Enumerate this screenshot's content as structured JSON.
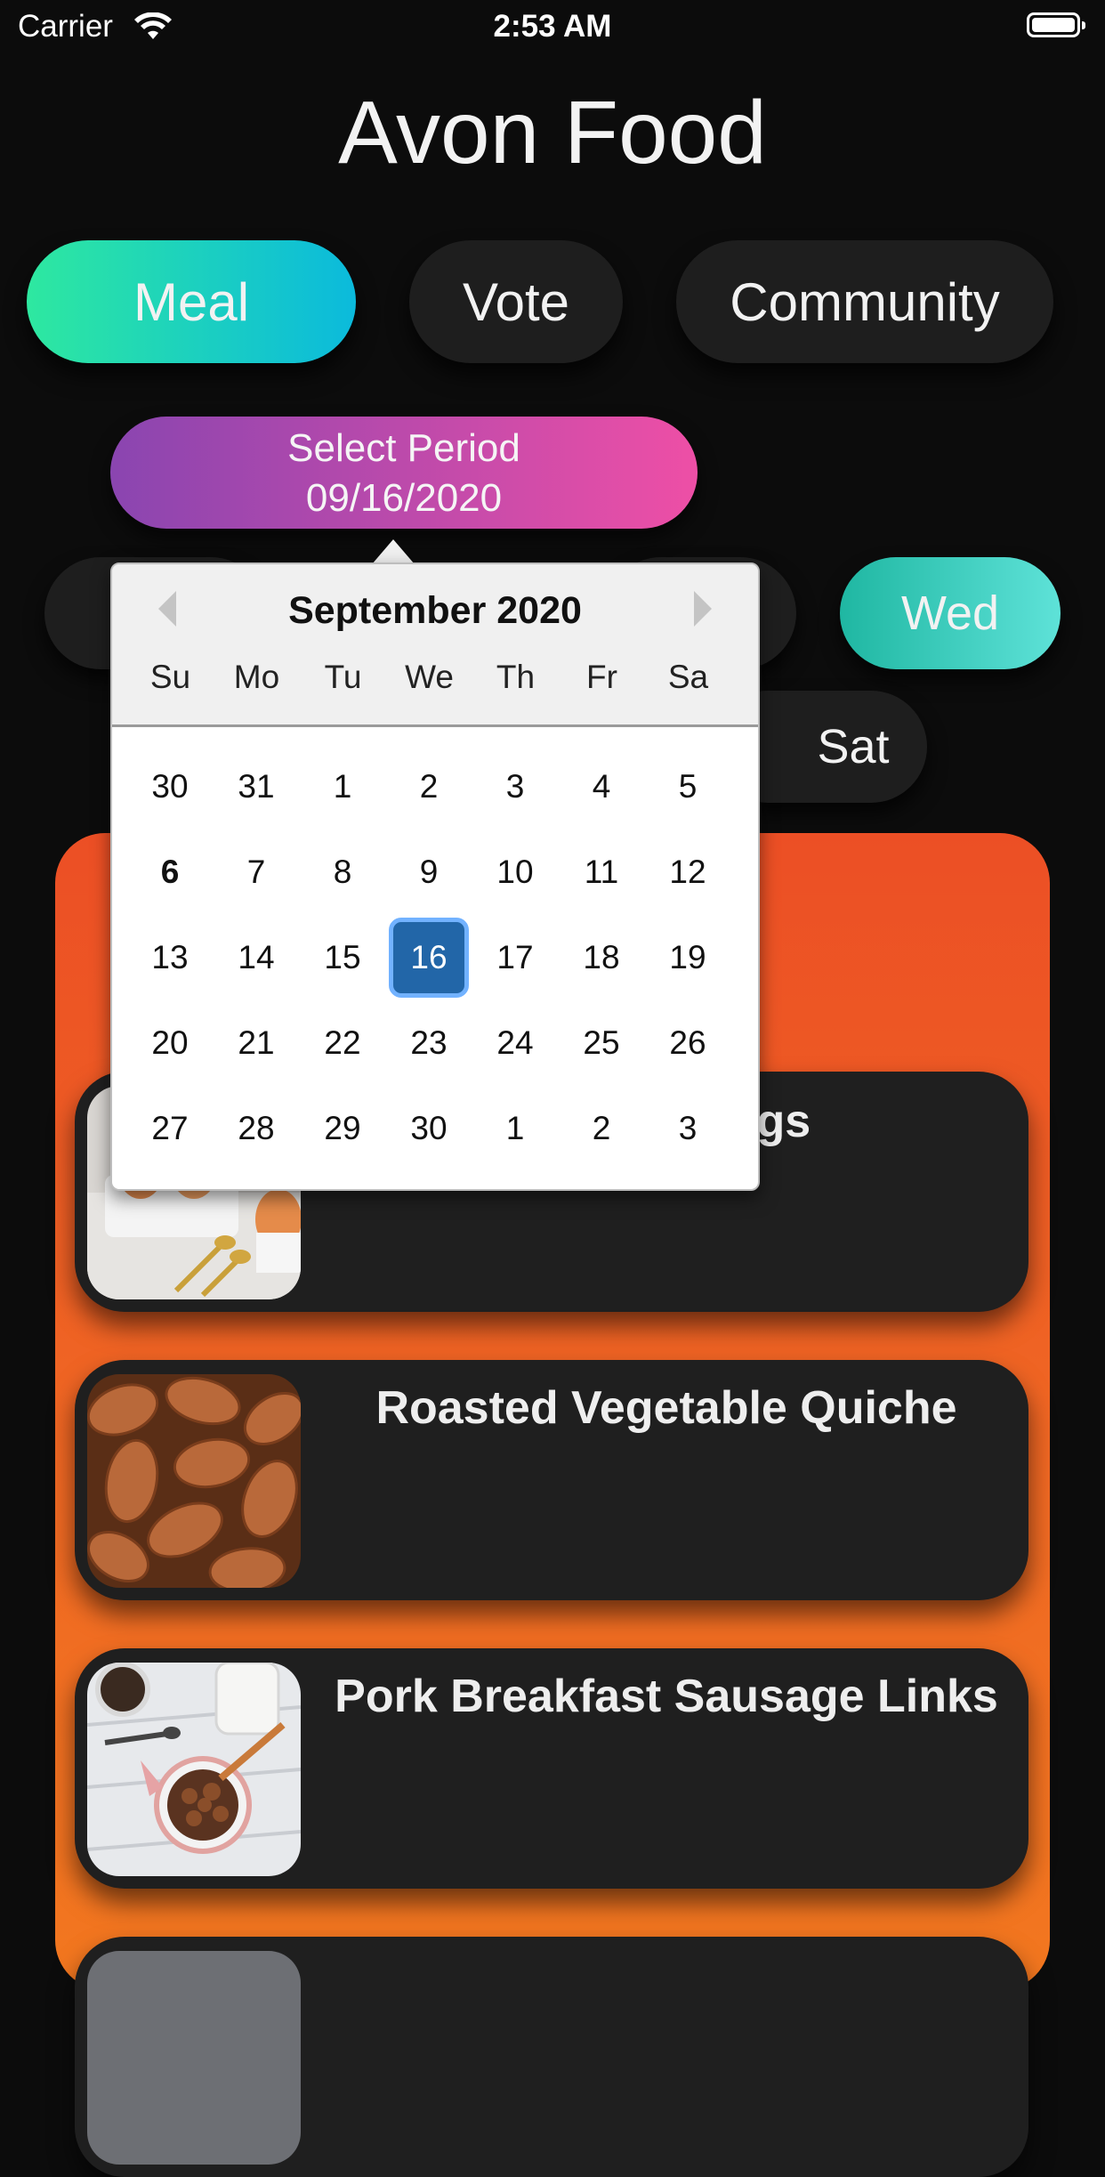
{
  "status_bar": {
    "carrier": "Carrier",
    "time": "2:53 AM"
  },
  "app": {
    "title": "Avon Food"
  },
  "tabs": [
    {
      "label": "Meal",
      "active": true
    },
    {
      "label": "Vote",
      "active": false
    },
    {
      "label": "Community",
      "active": false
    }
  ],
  "select_period": {
    "label": "Select Period",
    "date": "09/16/2020"
  },
  "days": [
    {
      "label": "Wed",
      "active": true
    },
    {
      "label": "Sat",
      "active": false
    }
  ],
  "calendar": {
    "month_label": "September 2020",
    "weekdays": [
      "Su",
      "Mo",
      "Tu",
      "We",
      "Th",
      "Fr",
      "Sa"
    ],
    "weeks": [
      [
        "30",
        "31",
        "1",
        "2",
        "3",
        "4",
        "5"
      ],
      [
        "6",
        "7",
        "8",
        "9",
        "10",
        "11",
        "12"
      ],
      [
        "13",
        "14",
        "15",
        "16",
        "17",
        "18",
        "19"
      ],
      [
        "20",
        "21",
        "22",
        "23",
        "24",
        "25",
        "26"
      ],
      [
        "27",
        "28",
        "29",
        "30",
        "1",
        "2",
        "3"
      ]
    ],
    "selected_day": "16",
    "bold_day": "6"
  },
  "meals": [
    {
      "title": "Eggs",
      "image": "eggs-photo"
    },
    {
      "title": "Roasted Vegetable Quiche",
      "image": "almonds-photo"
    },
    {
      "title": "Pork Breakfast Sausage Links",
      "image": "cereal-photo"
    }
  ],
  "colors": {
    "background": "#0c0c0c",
    "panel": "#ef5f24",
    "tab_active_gradient": [
      "#2ee8a0",
      "#0bbadc"
    ],
    "select_period_gradient": [
      "#8a45b0",
      "#ee4fa6"
    ],
    "calendar_selected": "#2266a8"
  }
}
